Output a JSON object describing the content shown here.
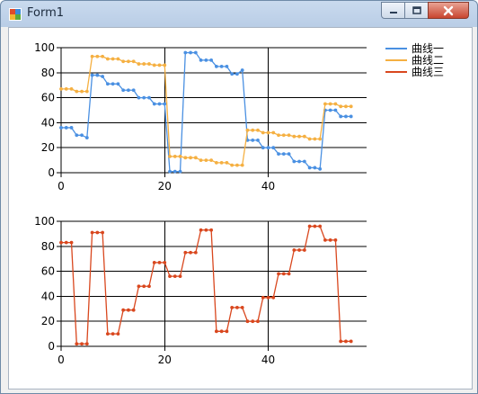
{
  "window": {
    "title": "Form1"
  },
  "legend": {
    "items": [
      {
        "label": "曲线一",
        "color": "#4a90e2"
      },
      {
        "label": "曲线二",
        "color": "#f5b042"
      },
      {
        "label": "曲线三",
        "color": "#d9471e"
      }
    ]
  },
  "chart_data": [
    {
      "type": "line",
      "xlim": [
        0,
        59
      ],
      "ylim": [
        0,
        100
      ],
      "x_ticks": [
        "0",
        "20",
        "40"
      ],
      "y_ticks": [
        "0",
        "20",
        "40",
        "60",
        "80",
        "100"
      ],
      "grid": true,
      "legend_position": "top-right",
      "series": [
        {
          "name": "曲线一",
          "color": "#4a90e2",
          "values": [
            36,
            36,
            36,
            30,
            30,
            28,
            78,
            78,
            77,
            71,
            71,
            71,
            66,
            66,
            66,
            60,
            60,
            60,
            55,
            55,
            55,
            1,
            1,
            1,
            96,
            96,
            96,
            90,
            90,
            90,
            85,
            85,
            85,
            79,
            79,
            82,
            26,
            26,
            26,
            20,
            20,
            20,
            15,
            15,
            15,
            9,
            9,
            9,
            4,
            4,
            3,
            50,
            50,
            50,
            45,
            45,
            45
          ]
        },
        {
          "name": "曲线二",
          "color": "#f5b042",
          "values": [
            67,
            67,
            67,
            65,
            65,
            65,
            93,
            93,
            93,
            91,
            91,
            91,
            89,
            89,
            89,
            87,
            87,
            87,
            86,
            86,
            86,
            13,
            13,
            13,
            12,
            12,
            12,
            10,
            10,
            10,
            8,
            8,
            8,
            6,
            6,
            6,
            34,
            34,
            34,
            32,
            32,
            32,
            30,
            30,
            30,
            29,
            29,
            29,
            27,
            27,
            27,
            55,
            55,
            55,
            53,
            53,
            53
          ]
        }
      ]
    },
    {
      "type": "line",
      "xlim": [
        0,
        59
      ],
      "ylim": [
        0,
        100
      ],
      "x_ticks": [
        "0",
        "20",
        "40"
      ],
      "y_ticks": [
        "0",
        "20",
        "40",
        "60",
        "80",
        "100"
      ],
      "grid": true,
      "series": [
        {
          "name": "曲线三",
          "color": "#d9471e",
          "values": [
            83,
            83,
            83,
            2,
            2,
            2,
            91,
            91,
            91,
            10,
            10,
            10,
            29,
            29,
            29,
            48,
            48,
            48,
            67,
            67,
            67,
            56,
            56,
            56,
            75,
            75,
            75,
            93,
            93,
            93,
            12,
            12,
            12,
            31,
            31,
            31,
            20,
            20,
            20,
            39,
            39,
            39,
            58,
            58,
            58,
            77,
            77,
            77,
            96,
            96,
            96,
            85,
            85,
            85,
            4,
            4,
            4
          ]
        }
      ]
    }
  ]
}
